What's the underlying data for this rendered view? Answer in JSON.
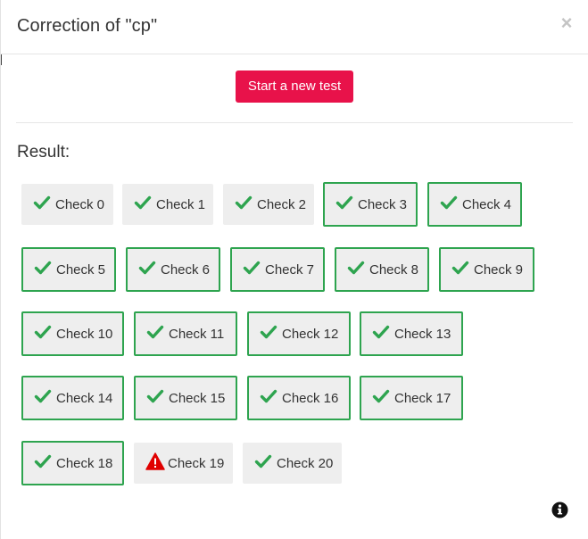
{
  "modal": {
    "title": "Correction of \"cp\"",
    "close_symbol": "×",
    "new_test_label": "Start a new test",
    "result_label": "Result:"
  },
  "colors": {
    "accent": "#e8124a",
    "pass": "#2ea44f",
    "warn": "#e00000",
    "chip_bg": "#eeeeee"
  },
  "checks": [
    {
      "label": "Check 0",
      "status": "pass",
      "icon": "checkmark-icon",
      "selected": false
    },
    {
      "label": "Check 1",
      "status": "pass",
      "icon": "checkmark-icon",
      "selected": false
    },
    {
      "label": "Check 2",
      "status": "pass",
      "icon": "checkmark-icon",
      "selected": false
    },
    {
      "label": "Check 3",
      "status": "pass",
      "icon": "checkmark-icon",
      "selected": true
    },
    {
      "label": "Check 4",
      "status": "pass",
      "icon": "checkmark-icon",
      "selected": true
    },
    {
      "label": "Check 5",
      "status": "pass",
      "icon": "checkmark-icon",
      "selected": true
    },
    {
      "label": "Check 6",
      "status": "pass",
      "icon": "checkmark-icon",
      "selected": true
    },
    {
      "label": "Check 7",
      "status": "pass",
      "icon": "checkmark-icon",
      "selected": true
    },
    {
      "label": "Check 8",
      "status": "pass",
      "icon": "checkmark-icon",
      "selected": true
    },
    {
      "label": "Check 9",
      "status": "pass",
      "icon": "checkmark-icon",
      "selected": true
    },
    {
      "label": "Check 10",
      "status": "pass",
      "icon": "checkmark-icon",
      "selected": true
    },
    {
      "label": "Check 11",
      "status": "pass",
      "icon": "checkmark-icon",
      "selected": true
    },
    {
      "label": "Check 12",
      "status": "pass",
      "icon": "checkmark-icon",
      "selected": true
    },
    {
      "label": "Check 13",
      "status": "pass",
      "icon": "checkmark-icon",
      "selected": true
    },
    {
      "label": "Check 14",
      "status": "pass",
      "icon": "checkmark-icon",
      "selected": true
    },
    {
      "label": "Check 15",
      "status": "pass",
      "icon": "checkmark-icon",
      "selected": true
    },
    {
      "label": "Check 16",
      "status": "pass",
      "icon": "checkmark-icon",
      "selected": true
    },
    {
      "label": "Check 17",
      "status": "pass",
      "icon": "checkmark-icon",
      "selected": true
    },
    {
      "label": "Check 18",
      "status": "pass",
      "icon": "checkmark-icon",
      "selected": true
    },
    {
      "label": "Check 19",
      "status": "warning",
      "icon": "warning-triangle-icon",
      "selected": false
    },
    {
      "label": "Check 20",
      "status": "pass",
      "icon": "checkmark-icon",
      "selected": false
    }
  ],
  "footer": {
    "info_icon": "info-icon"
  }
}
